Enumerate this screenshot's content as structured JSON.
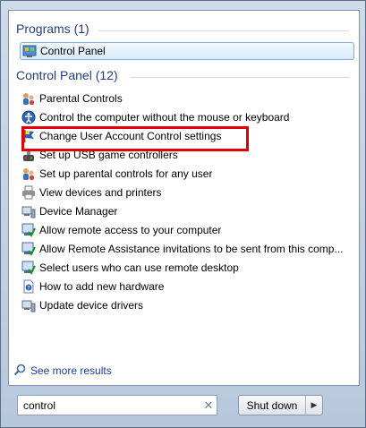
{
  "programs": {
    "header": "Programs (1)",
    "items": [
      {
        "label": "Control Panel",
        "icon": "control-panel-icon"
      }
    ]
  },
  "control_panel": {
    "header": "Control Panel (12)",
    "items": [
      {
        "label": "Parental Controls",
        "icon": "parental-controls-icon"
      },
      {
        "label": "Control the computer without the mouse or keyboard",
        "icon": "ease-of-access-icon"
      },
      {
        "label": "Change User Account Control settings",
        "icon": "uac-flag-icon"
      },
      {
        "label": "Set up USB game controllers",
        "icon": "game-controller-icon"
      },
      {
        "label": "Set up parental controls for any user",
        "icon": "parental-controls-icon"
      },
      {
        "label": "View devices and printers",
        "icon": "printer-icon"
      },
      {
        "label": "Device Manager",
        "icon": "device-manager-icon"
      },
      {
        "label": "Allow remote access to your computer",
        "icon": "system-check-icon"
      },
      {
        "label": "Allow Remote Assistance invitations to be sent from this comp...",
        "icon": "system-check-icon"
      },
      {
        "label": "Select users who can use remote desktop",
        "icon": "system-check-icon"
      },
      {
        "label": "How to add new hardware",
        "icon": "help-page-icon"
      },
      {
        "label": "Update device drivers",
        "icon": "device-driver-icon"
      }
    ]
  },
  "see_more": "See more results",
  "search": {
    "value": "control"
  },
  "shutdown": {
    "label": "Shut down"
  },
  "colors": {
    "header": "#1e3e8c",
    "highlight": "#e00000",
    "link": "#1a3f9a"
  }
}
